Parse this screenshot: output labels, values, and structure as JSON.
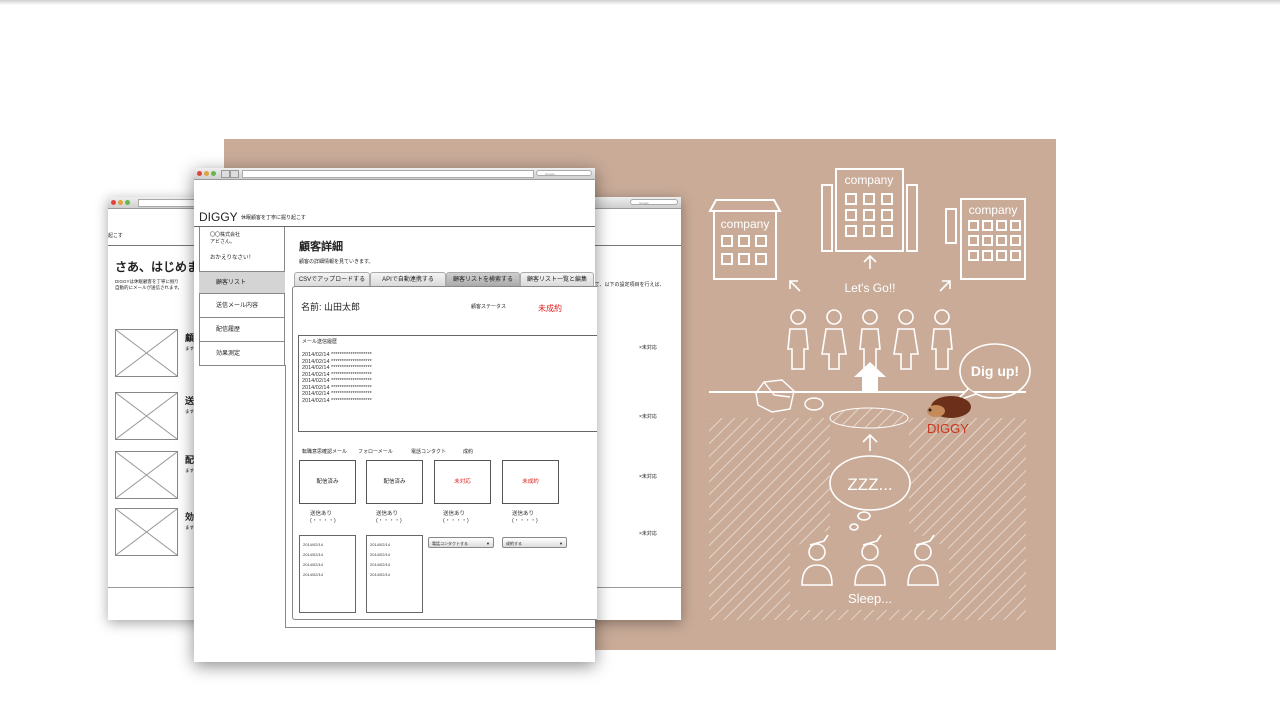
{
  "illustration": {
    "company_label_1": "company",
    "company_label_2": "company",
    "company_label_3": "company",
    "lets_go": "Let's Go!!",
    "dig_up": "Dig up!",
    "brand": "DIGGY",
    "zzz": "ZZZ...",
    "sleep": "Sleep...",
    "bg_color": "#c9ab98",
    "line_color": "#ffffff",
    "brand_color": "#c8361d"
  },
  "left_window": {
    "header_fragment": "起こす",
    "heading": "さあ、はじめまし",
    "intro_line1": "DIGGYは休眠顧客を丁寧に掘り",
    "intro_line2": "自動的にメールが送信されます。",
    "item_titles": [
      "顧",
      "送",
      "配",
      "効"
    ],
    "item_subs": [
      "ます",
      "ます",
      "ます",
      "ます"
    ]
  },
  "right_window": {
    "intro_fragment": "って、以下の設定項目を行えば、",
    "statuses": [
      "×未対応",
      "×未対応",
      "×未対応",
      "×未対応"
    ]
  },
  "main_window": {
    "logo": "DIGGY",
    "tagline": "休眠顧客を丁寧に掘り起こす",
    "company": "〇〇株式会社",
    "user": "アビさん。",
    "welcome": "おかえりなさい！",
    "nav": [
      "顧客リスト",
      "送信メール内容",
      "配信履歴",
      "効果測定"
    ],
    "page_title": "顧客詳細",
    "page_desc": "顧客の詳細情報を見ていきます。",
    "tabs": [
      "CSVでアップロードする",
      "APIで自動連携する",
      "顧客リストを検索する",
      "顧客リスト一覧と編集"
    ],
    "name_label": "名前: 山田太郎",
    "status_label": "顧客ステータス",
    "status_value": "未成約",
    "mail_history_title": "メール送信履歴",
    "mail_history": [
      "2014/02/14 *******************",
      "2014/02/14 *******************",
      "2014/02/14 *******************",
      "2014/02/14 *******************",
      "2014/02/14 *******************",
      "2014/02/14 *******************",
      "2014/02/14 *******************",
      "2014/02/14 *******************"
    ],
    "steps": [
      "転職意思確認メール",
      "フォローメール",
      "電話コンタクト",
      "成約"
    ],
    "step_values": [
      "配信済み",
      "配信済み",
      "未対応",
      "未成約"
    ],
    "sent_label": "送信あり",
    "sent_sub": "(・・・・)",
    "log_dates": [
      "2014/02/14",
      "2014/02/14",
      "2014/02/14",
      "2014/02/14"
    ],
    "select_phone": "電話コンタクトする",
    "select_deal": "成約する",
    "url_search": "Google",
    "alert_color": "#e02020"
  }
}
